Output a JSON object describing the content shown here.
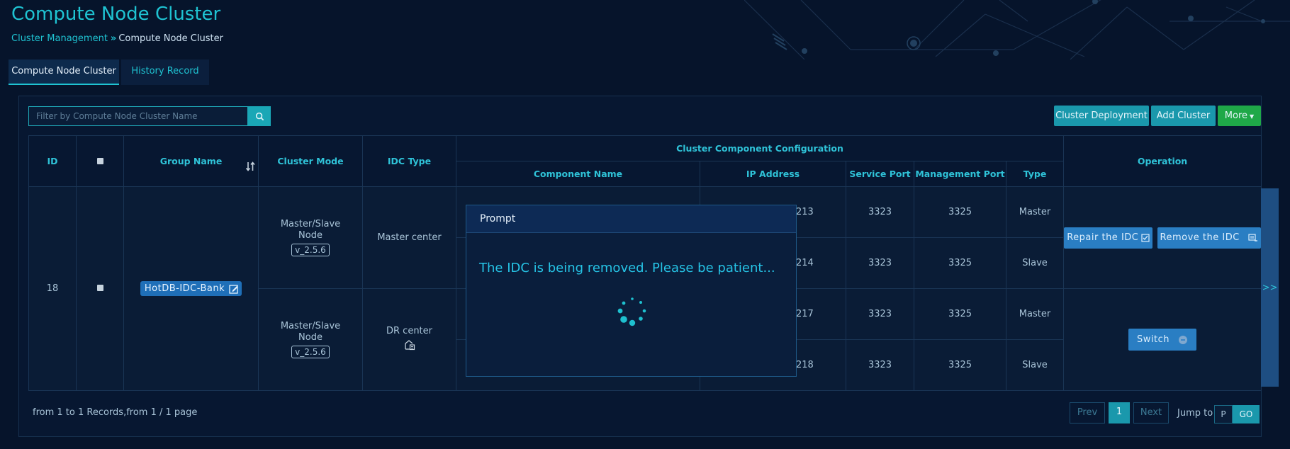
{
  "header": {
    "title": "Compute Node Cluster",
    "breadcrumb": [
      "Cluster Management",
      "Compute Node Cluster"
    ]
  },
  "tabs": [
    {
      "label": "Compute Node Cluster",
      "active": true
    },
    {
      "label": "History Record",
      "active": false
    }
  ],
  "toolbar": {
    "search_placeholder": "Filter by Compute Node Cluster Name",
    "buttons": {
      "deploy": "Cluster Deployment",
      "add": "Add Cluster",
      "more": "More"
    }
  },
  "table": {
    "headers": {
      "id": "ID",
      "group_name": "Group Name",
      "cluster_mode": "Cluster Mode",
      "idc_type": "IDC Type",
      "component_config": "Cluster Component Configuration",
      "component_name": "Component Name",
      "ip_address": "IP Address",
      "service_port": "Service Port",
      "management_port": "Management Port",
      "type": "Type",
      "operation": "Operation"
    },
    "record": {
      "id": "18",
      "group_name": "HotDB-IDC-Bank",
      "clusters": [
        {
          "mode": "Master/Slave Node",
          "version": "v_2.5.6",
          "idc_type": "Master center"
        },
        {
          "mode": "Master/Slave Node",
          "version": "v_2.5.6",
          "idc_type": "DR center"
        }
      ],
      "rows": [
        {
          "ip_tail": "213",
          "service_port": "3323",
          "management_port": "3325",
          "type": "Master"
        },
        {
          "ip_tail": "214",
          "service_port": "3323",
          "management_port": "3325",
          "type": "Slave"
        },
        {
          "ip_tail": "217",
          "service_port": "3323",
          "management_port": "3325",
          "type": "Master"
        },
        {
          "ip_tail": "218",
          "service_port": "3323",
          "management_port": "3325",
          "type": "Slave"
        }
      ],
      "ops": {
        "repair": "Repair the IDC",
        "remove": "Remove the IDC",
        "switch": "Switch"
      }
    }
  },
  "side_toggle": ">>",
  "footer": {
    "records_info": "from 1 to 1 Records,from 1 / 1 page",
    "prev": "Prev",
    "current_page": "1",
    "next": "Next",
    "jump_label": "Jump to",
    "page_placeholder": "P",
    "go": "GO"
  },
  "modal": {
    "title": "Prompt",
    "message": "The IDC is being removed. Please be patient..."
  },
  "colors": {
    "accent": "#1fc3d2",
    "background": "#06142b",
    "primary_button": "#1a98ac",
    "green_button": "#1fa848"
  }
}
